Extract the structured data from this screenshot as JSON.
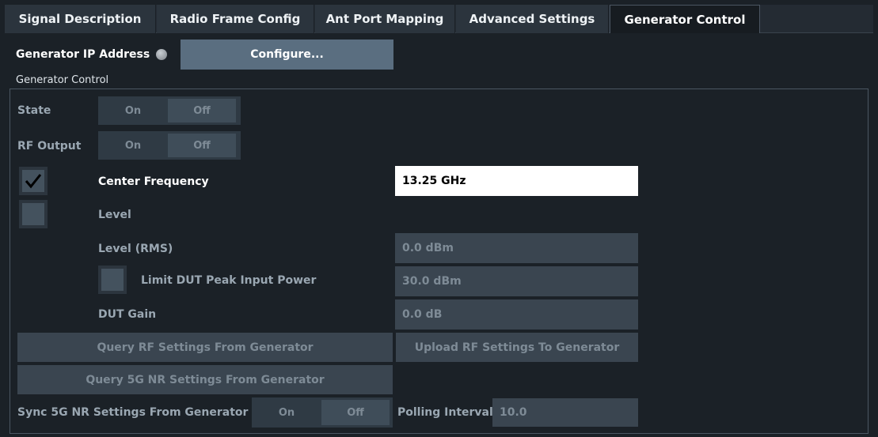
{
  "tabs": [
    {
      "label": "Signal Description",
      "active": false
    },
    {
      "label": "Radio Frame Config",
      "active": false
    },
    {
      "label": "Ant Port Mapping",
      "active": false
    },
    {
      "label": "Advanced Settings",
      "active": false
    },
    {
      "label": "Generator Control",
      "active": true
    }
  ],
  "generator_ip": {
    "label": "Generator IP Address",
    "configure_label": "Configure..."
  },
  "group_title": "Generator Control",
  "state": {
    "label": "State",
    "on": "On",
    "off": "Off",
    "selected": "Off"
  },
  "rf_output": {
    "label": "RF Output",
    "on": "On",
    "off": "Off",
    "selected": "Off"
  },
  "center_frequency": {
    "label": "Center Frequency",
    "value": "13.25 GHz",
    "checked": true
  },
  "level": {
    "label": "Level",
    "checked": false
  },
  "level_rms": {
    "label": "Level (RMS)",
    "value": "0.0 dBm"
  },
  "limit_dut": {
    "label": "Limit DUT Peak Input Power",
    "value": "30.0 dBm",
    "checked": false
  },
  "dut_gain": {
    "label": "DUT Gain",
    "value": "0.0 dB"
  },
  "buttons": {
    "query_rf": "Query RF Settings From Generator",
    "upload_rf": "Upload RF Settings To Generator",
    "query_5g": "Query 5G NR Settings From Generator"
  },
  "sync_5g": {
    "label": "Sync 5G NR Settings From Generator",
    "on": "On",
    "off": "Off",
    "selected": "Off"
  },
  "polling": {
    "label": "Polling Interval",
    "value": "10.0"
  },
  "colors": {
    "background": "#1b2127",
    "enabled_button": "#5a6e80",
    "disabled_control": "#3a4550",
    "input_background": "#ffffff"
  }
}
